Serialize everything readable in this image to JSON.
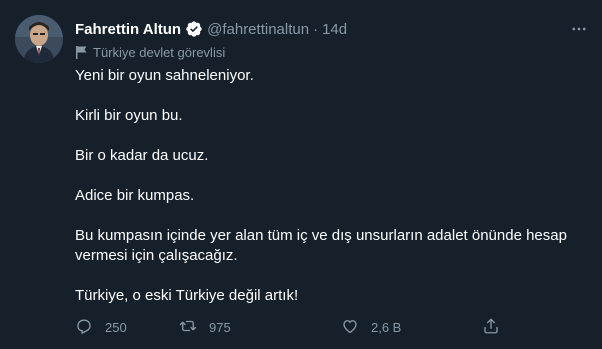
{
  "tweet": {
    "display_name": "Fahrettin Altun",
    "handle": "@fahrettinaltun",
    "separator": "·",
    "time": "14d",
    "label": "Türkiye devlet görevlisi",
    "paragraphs": [
      "Yeni bir oyun sahneleniyor.",
      "Kirli bir oyun bu.",
      "Bir o kadar da ucuz.",
      "Adice bir kumpas.",
      "Bu kumpasın içinde yer alan tüm iç ve dış unsurların adalet önünde hesap vermesi için çalışacağız.",
      "Türkiye, o eski Türkiye değil artık!"
    ],
    "actions": {
      "reply_count": "250",
      "retweet_count": "975",
      "like_count": "2,6 B"
    }
  },
  "colors": {
    "background": "#15202b",
    "text": "#ffffff",
    "muted": "#8899a6",
    "verified": "#ffffff"
  },
  "icons": [
    "more-icon",
    "verified-icon",
    "flag-icon",
    "reply-icon",
    "retweet-icon",
    "like-icon",
    "share-icon"
  ]
}
